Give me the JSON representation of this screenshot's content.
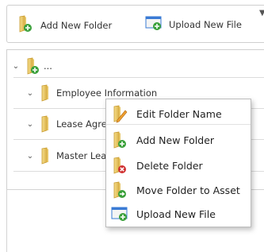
{
  "toolbar": {
    "add_folder_label": "Add New Folder",
    "upload_file_label": "Upload New File",
    "overflow_glyph": "▼"
  },
  "tree": {
    "root": {
      "label": "...",
      "chevron": "⌄"
    },
    "items": [
      {
        "label": "Employee Information",
        "chevron": "⌄"
      },
      {
        "label": "Lease Agreements",
        "chevron": "⌄"
      },
      {
        "label": "Master Lease",
        "chevron": "⌄"
      }
    ]
  },
  "context_menu": {
    "items": [
      {
        "label": "Edit Folder Name",
        "icon": "folder-pencil-icon"
      },
      {
        "label": "Add New Folder",
        "icon": "folder-add-icon"
      },
      {
        "label": "Delete Folder",
        "icon": "folder-delete-icon"
      },
      {
        "label": "Move Folder to Asset",
        "icon": "folder-move-icon"
      },
      {
        "label": "Upload New File",
        "icon": "upload-file-icon"
      }
    ]
  },
  "colors": {
    "folder_yellow": "#e9c45a",
    "badge_green": "#3aa03a",
    "badge_red": "#d03030",
    "pencil_orange": "#f0a030",
    "upload_blue": "#3a7bd5"
  }
}
